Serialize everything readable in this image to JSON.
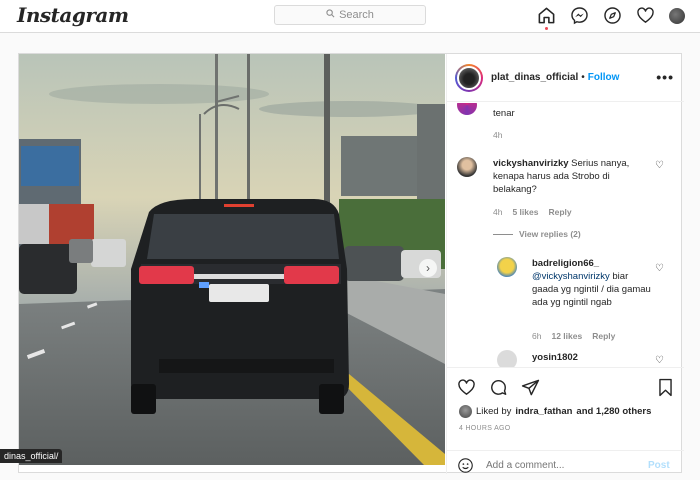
{
  "header": {
    "logo": "Instagram",
    "search_placeholder": "Search",
    "nav_icons": [
      "home-icon",
      "messenger-icon",
      "explore-icon",
      "heart-icon",
      "profile-avatar"
    ],
    "accent": "#ed4956"
  },
  "post": {
    "username": "plat_dinas_official",
    "separator": "•",
    "follow_label": "Follow",
    "more_label": "•••",
    "image_alt": "Black car on highway with flashing lights"
  },
  "comments": {
    "first": {
      "text": "tenar",
      "time": "4h"
    },
    "second": {
      "user": "vickyshanvirizky",
      "text": "Serius nanya, kenapa harus ada Strobo di belakang?",
      "time": "4h",
      "likes": "5 likes",
      "reply": "Reply"
    },
    "view_replies": "View replies (2)",
    "third": {
      "user": "badreligion66_",
      "mention": "@vickyshanvirizky",
      "text": " biar gaada yg ngintil / dia gamau ada yg ngintil ngab",
      "time": "6h",
      "likes": "12 likes",
      "reply": "Reply"
    },
    "fourth": {
      "user": "yosin1802"
    }
  },
  "actions": {
    "liked_by_prefix": "Liked by",
    "liked_by_user": "indra_fathan",
    "liked_by_suffix": "and 1,280 others",
    "timestamp": "4 HOURS AGO",
    "add_comment_placeholder": "Add a comment...",
    "post_label": "Post"
  },
  "tooltip": "dinas_official/",
  "colors": {
    "link": "#0095f6",
    "post_disabled": "#b2dffc"
  }
}
